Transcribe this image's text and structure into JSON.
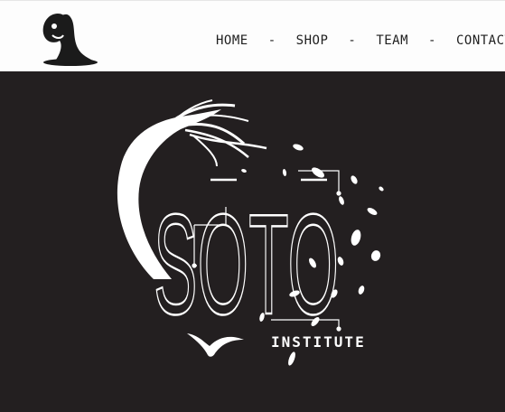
{
  "nav": {
    "items": [
      {
        "label": "HOME"
      },
      {
        "label": "SHOP"
      },
      {
        "label": "TEAM"
      },
      {
        "label": "CONTACT"
      }
    ],
    "separator": "-"
  },
  "hero": {
    "brand_word": "SOTO",
    "brand_sub": "INSTITUTE"
  },
  "colors": {
    "header_bg": "#fdfdfd",
    "hero_bg": "#231f20",
    "foreground": "#ffffff",
    "nav_text": "#1f1f1f"
  },
  "icons": [
    "site-logo-icon",
    "tree-icon",
    "bird-icon",
    "leaf-icon"
  ]
}
